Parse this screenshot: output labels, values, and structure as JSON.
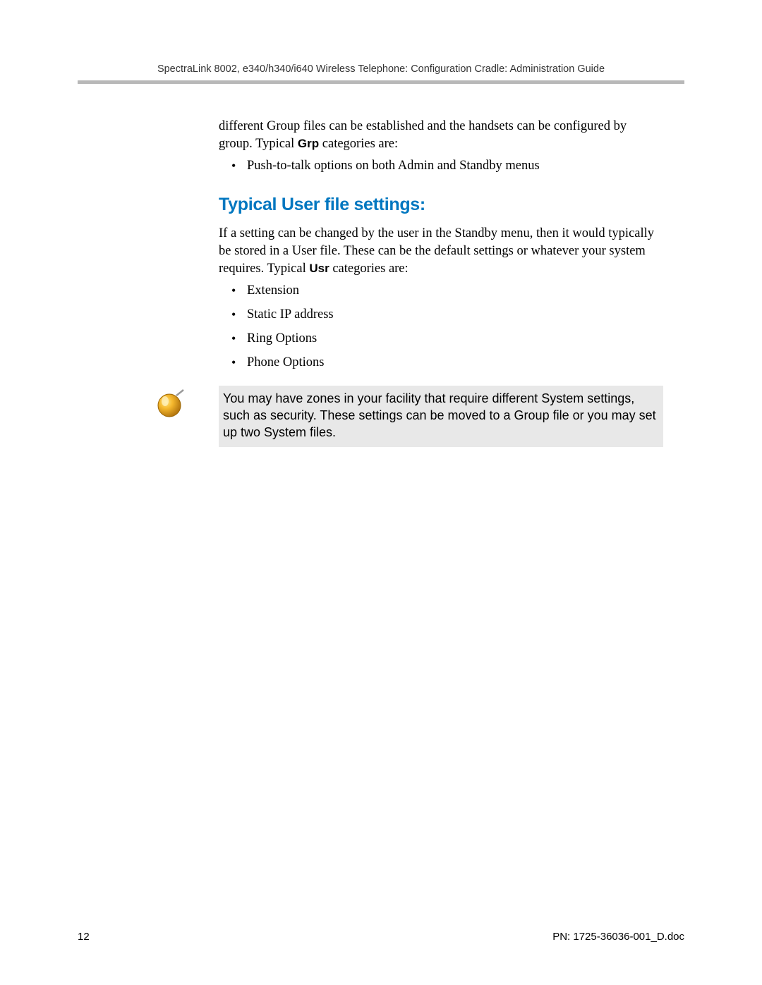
{
  "header": {
    "title": "SpectraLink 8002, e340/h340/i640 Wireless Telephone: Configuration Cradle: Administration Guide"
  },
  "intro": {
    "text_before_bold": "different Group files can be established and the handsets can be configured by group. Typical ",
    "bold_word": "Grp",
    "text_after_bold": " categories are:"
  },
  "first_bullets": {
    "items": [
      "Push-to-talk options on both Admin and Standby menus"
    ]
  },
  "section": {
    "heading": "Typical User file settings:",
    "para_before_bold": "If a setting can be changed by the user in the Standby menu, then it would typically be stored in a User file. These can be the default settings or whatever your system requires. Typical ",
    "para_bold": "Usr",
    "para_after_bold": " categories are:"
  },
  "second_bullets": {
    "items": [
      "Extension",
      "Static IP address",
      "Ring Options",
      "Phone Options"
    ]
  },
  "note": {
    "text": "You may have zones in your facility that require different System settings, such as security. These settings can be moved to a Group file or you may set up two System files."
  },
  "footer": {
    "page_number": "12",
    "doc_ref": "PN: 1725-36036-001_D.doc"
  }
}
